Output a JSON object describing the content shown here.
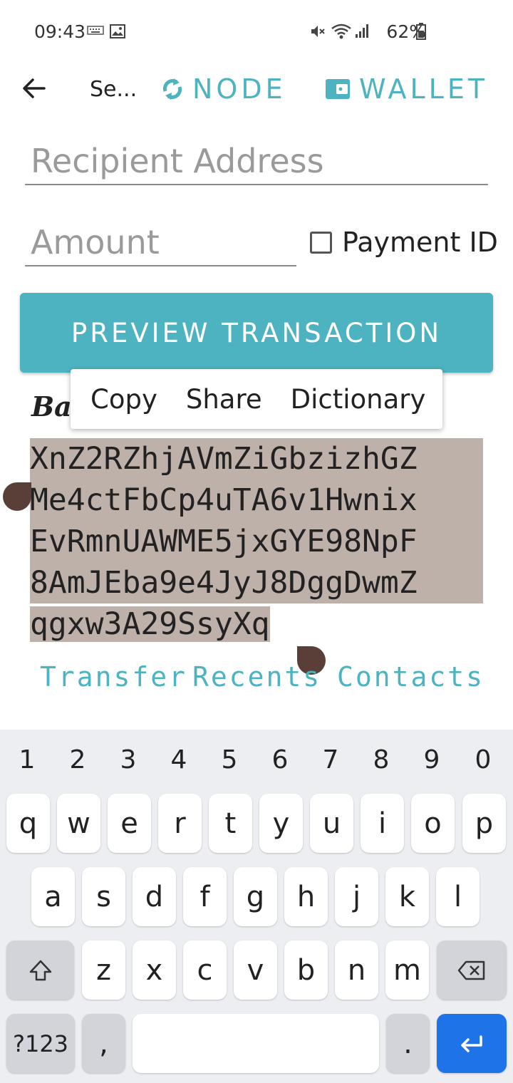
{
  "status_bar": {
    "time": "09:43",
    "battery": "62%",
    "icons": [
      "keyboard-icon",
      "image-icon",
      "mute-icon",
      "wifi-icon",
      "signal-icon",
      "battery-icon"
    ]
  },
  "app_bar": {
    "title": "Se...",
    "node_label": "NODE",
    "wallet_label": "WALLET",
    "accent_color": "#4eb3c0"
  },
  "form": {
    "recipient_placeholder": "Recipient Address",
    "amount_placeholder": "Amount",
    "payment_id_label": "Payment ID",
    "payment_id_checked": false,
    "preview_button_label": "PREVIEW TRANSACTION"
  },
  "context_menu": {
    "items": [
      "Copy",
      "Share",
      "Dictionary"
    ]
  },
  "balance": {
    "label": "Ba",
    "address_lines": [
      "XnZ2RZhjAVmZiGbzizhGZ",
      "Me4ctFbCp4uTA6v1Hwnix",
      "EvRmnUAWME5jxGYE98NpF",
      "8AmJEba9e4JyJ8DggDwmZ",
      "qgxw3A29SsyXq"
    ],
    "selection_color": "#bdb1aa"
  },
  "tabs": {
    "transfer": "Transfer",
    "recents": "Recents",
    "contacts": "Contacts"
  },
  "keyboard": {
    "numbers": [
      "1",
      "2",
      "3",
      "4",
      "5",
      "6",
      "7",
      "8",
      "9",
      "0"
    ],
    "row1": [
      "q",
      "w",
      "e",
      "r",
      "t",
      "y",
      "u",
      "i",
      "o",
      "p"
    ],
    "row2": [
      "a",
      "s",
      "d",
      "f",
      "g",
      "h",
      "j",
      "k",
      "l"
    ],
    "row3": [
      "z",
      "x",
      "c",
      "v",
      "b",
      "n",
      "m"
    ],
    "symbols_label": "?123",
    "comma": ",",
    "period": ".",
    "enter_color": "#1e73e8"
  }
}
